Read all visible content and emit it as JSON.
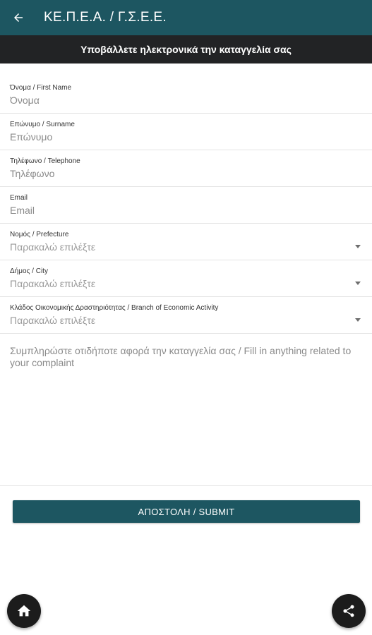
{
  "appbar": {
    "title": "ΚΕ.Π.Ε.Α. / Γ.Σ.Ε.Ε."
  },
  "subheader": {
    "text": "Υποβάλλετε ηλεκτρονικά την καταγγελία σας"
  },
  "fields": {
    "first_name": {
      "label": "Όνομα / First Name",
      "placeholder": "Όνομα"
    },
    "surname": {
      "label": "Επώνυμο / Surname",
      "placeholder": "Επώνυμο"
    },
    "telephone": {
      "label": "Τηλέφωνο / Telephone",
      "placeholder": "Τηλέφωνο"
    },
    "email": {
      "label": "Email",
      "placeholder": "Email"
    },
    "prefecture": {
      "label": "Νομός / Prefecture",
      "value": "Παρακαλώ επιλέξτε"
    },
    "city": {
      "label": "Δήμος / City",
      "value": "Παρακαλώ επιλέξτε"
    },
    "activity": {
      "label": "Κλάδος Οικονομικής Δραστηριότητας / Branch of Economic Activity",
      "value": "Παρακαλώ επιλέξτε"
    }
  },
  "complaint": {
    "placeholder": "Συμπληρώστε οτιδήποτε αφορά την καταγγελία σας / Fill in anything related to your complaint"
  },
  "submit": {
    "label": "ΑΠΟΣΤΟΛΗ / SUBMIT"
  },
  "icons": {
    "back": "arrow-left-icon",
    "home": "home-icon",
    "share": "share-icon"
  },
  "colors": {
    "primary": "#1d5661",
    "subheader": "#222325",
    "fab": "#1c1c1c"
  }
}
